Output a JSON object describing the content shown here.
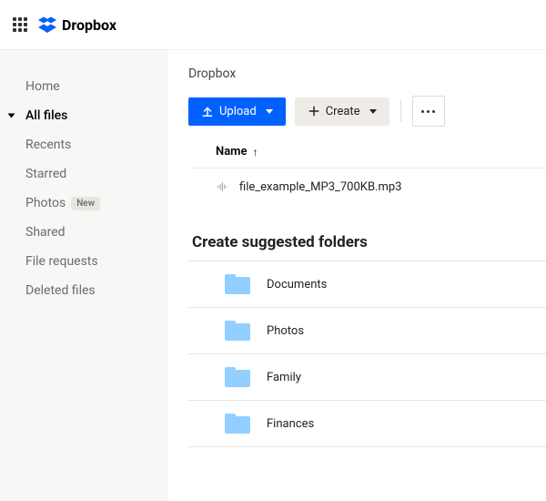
{
  "brand": {
    "name": "Dropbox"
  },
  "sidebar": {
    "items": [
      {
        "label": "Home",
        "active": false
      },
      {
        "label": "All files",
        "active": true
      },
      {
        "label": "Recents",
        "active": false
      },
      {
        "label": "Starred",
        "active": false
      },
      {
        "label": "Photos",
        "active": false,
        "badge": "New"
      },
      {
        "label": "Shared",
        "active": false
      },
      {
        "label": "File requests",
        "active": false
      },
      {
        "label": "Deleted files",
        "active": false
      }
    ]
  },
  "main": {
    "breadcrumb": "Dropbox",
    "toolbar": {
      "upload": "Upload",
      "create": "Create"
    },
    "listHeaders": {
      "name": "Name"
    },
    "files": [
      {
        "name": "file_example_MP3_700KB.mp3",
        "type": "audio"
      }
    ],
    "suggestedTitle": "Create suggested folders",
    "suggested": [
      {
        "name": "Documents"
      },
      {
        "name": "Photos"
      },
      {
        "name": "Family"
      },
      {
        "name": "Finances"
      }
    ]
  }
}
